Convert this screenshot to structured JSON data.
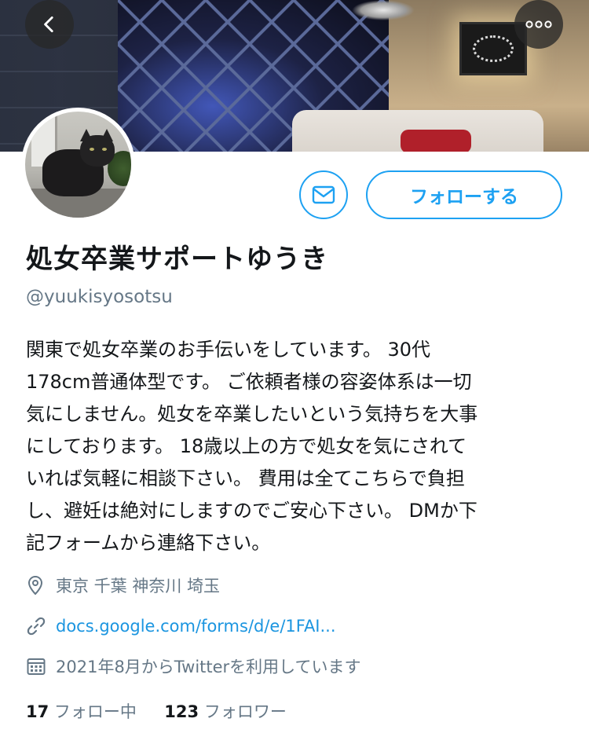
{
  "nav": {
    "back_icon": "chevron-left-icon",
    "more_icon": "more-dots-icon"
  },
  "profile": {
    "display_name": "処女卒業サポートゆうき",
    "handle": "@yuukisyosotsu",
    "bio": "関東で処女卒業のお手伝いをしています。 30代\n178cm普通体型です。 ご依頼者様の容姿体系は一切\n気にしません。処女を卒業したいという気持ちを大事\nにしております。 18歳以上の方で処女を気にされて\nいれば気軽に相談下さい。 費用は全てこちらで負担\nし、避妊は絶対にしますのでご安心下さい。 DMか下\n記フォームから連絡下さい。",
    "location": "東京 千葉 神奈川 埼玉",
    "link": "docs.google.com/forms/d/e/1FAI...",
    "joined": "2021年8月からTwitterを利用しています"
  },
  "actions": {
    "message_icon": "envelope-icon",
    "follow_label": "フォローする"
  },
  "stats": {
    "following_count": "17",
    "following_label": "フォロー中",
    "followers_count": "123",
    "followers_label": "フォロワー"
  },
  "colors": {
    "accent": "#1da1f2",
    "link": "#1b95e0",
    "secondary_text": "#657786",
    "primary_text": "#14171a"
  }
}
